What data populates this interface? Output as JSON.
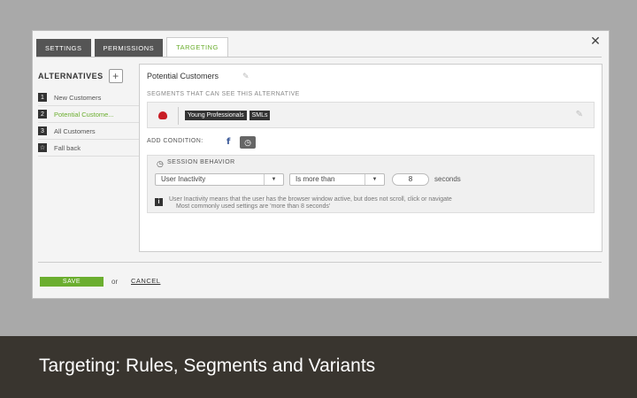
{
  "tabs": [
    {
      "label": "SETTINGS"
    },
    {
      "label": "PERMISSIONS"
    },
    {
      "label": "TARGETING",
      "active": true
    }
  ],
  "close_icon": "close-icon",
  "sidebar": {
    "title": "ALTERNATIVES",
    "add_label": "+",
    "items": [
      {
        "num": "1",
        "label": "New Customers"
      },
      {
        "num": "2",
        "label": "Potential Custome...",
        "active": true
      },
      {
        "num": "3",
        "label": "All Customers"
      },
      {
        "num": "☆",
        "label": "Fall back"
      }
    ]
  },
  "main": {
    "alternative_name": "Potential Customers",
    "segments_label": "SEGMENTS THAT CAN SEE THIS ALTERNATIVE",
    "segments": [
      "Young Professionals",
      "SMLs"
    ],
    "add_condition_label": "ADD CONDITION:",
    "behavior": {
      "title": "SESSION BEHAVIOR",
      "metric": "User Inactivity",
      "operator": "Is more than",
      "value": "8",
      "unit": "seconds",
      "info_line1": "User Inactivity means that the user has the browser window active, but does not scroll, click or navigate",
      "info_line2": "Most commonly used settings are 'more than 8 seconds'"
    }
  },
  "footer": {
    "save_label": "SAVE",
    "or_label": "or",
    "cancel_label": "CANCEL"
  },
  "caption": "Targeting: Rules, Segments and Variants",
  "colors": {
    "accent": "#6bae2f",
    "caption_bg": "#39352f",
    "facebook": "#3b5998"
  }
}
